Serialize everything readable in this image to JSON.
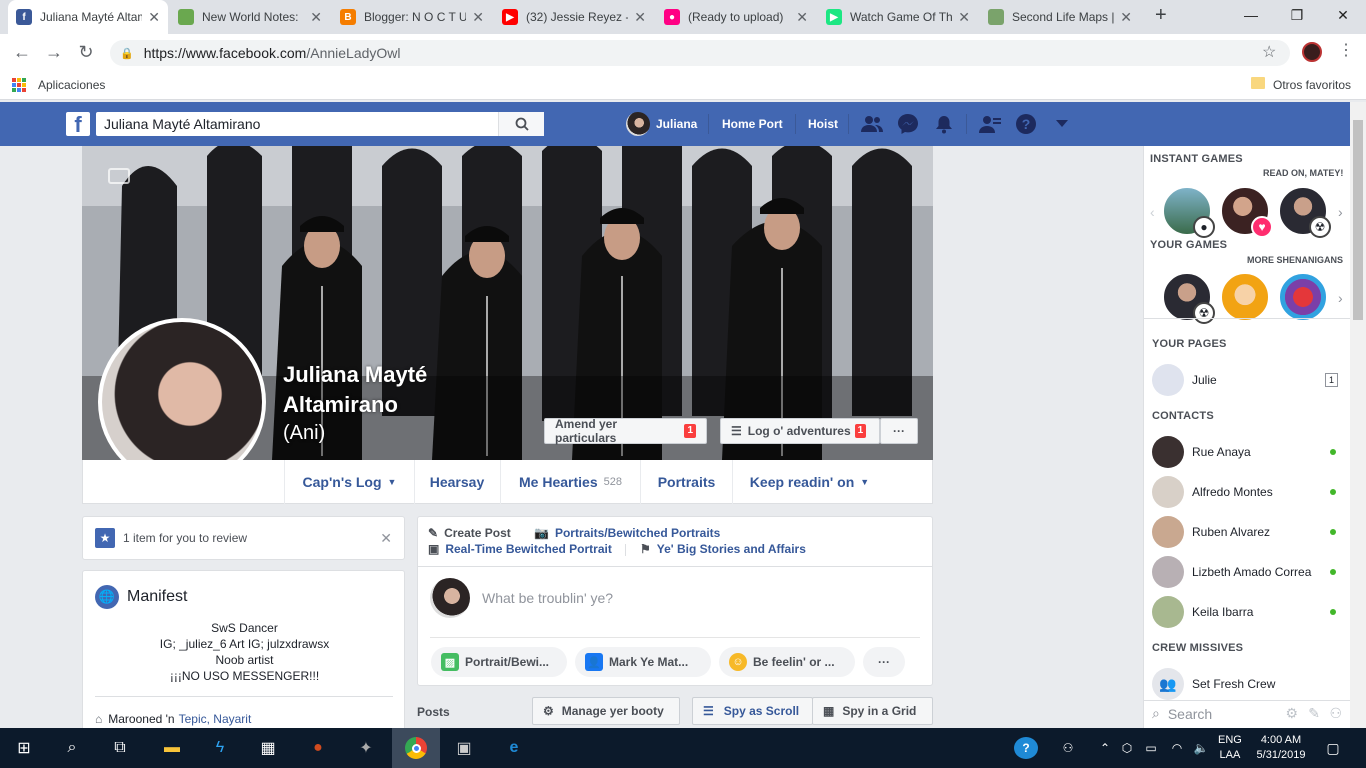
{
  "browser": {
    "tabs": [
      {
        "title": "Juliana Mayté Altami",
        "color": "#3b5998",
        "glyph": "f",
        "active": true
      },
      {
        "title": "New World Notes: ",
        "color": "#6aa84f",
        "glyph": "",
        "active": false
      },
      {
        "title": "Blogger: N O C T U",
        "color": "#f57d00",
        "glyph": "B",
        "active": false
      },
      {
        "title": "(32) Jessie Reyez - ",
        "color": "#ff0000",
        "glyph": "▶",
        "active": false
      },
      {
        "title": "(Ready to upload) ",
        "color": "#ff0084",
        "glyph": "●",
        "active": false
      },
      {
        "title": "Watch Game Of Thr",
        "color": "#1ce783",
        "glyph": "▶",
        "active": false
      },
      {
        "title": "Second Life Maps | ",
        "color": "#7aa36b",
        "glyph": "",
        "active": false
      }
    ],
    "new_tab": "+",
    "url_host": "https://www.facebook.com",
    "url_path": "/AnnieLadyOwl",
    "bookmarks_apps": "Aplicaciones",
    "bookmarks_other": "Otros favoritos"
  },
  "fb": {
    "search_value": "Juliana Mayté Altamirano",
    "nav_user": "Juliana",
    "nav_home": "Home Port",
    "nav_hoist": "Hoist"
  },
  "profile": {
    "name_line1": "Juliana Mayté",
    "name_line2": "Altamirano",
    "alt_name": "(Ani)",
    "btn_edit": "Amend yer particulars",
    "btn_edit_badge": "1",
    "btn_log": "Log o' adventures",
    "btn_log_badge": "1",
    "btn_more": "···",
    "tabs": [
      {
        "label": "Cap'n's Log",
        "count": "",
        "caret": true
      },
      {
        "label": "Hearsay",
        "count": "",
        "caret": false
      },
      {
        "label": "Me Hearties",
        "count": "528",
        "caret": false
      },
      {
        "label": "Portraits",
        "count": "",
        "caret": false
      },
      {
        "label": "Keep readin' on",
        "count": "",
        "caret": true
      }
    ]
  },
  "review": {
    "text": "1 item for you to review"
  },
  "intro": {
    "title": "Manifest",
    "bio": [
      "SwS Dancer",
      "IG; _juliez_6 Art IG; julzxdrawsx",
      "Noob artist",
      "¡¡¡NO USO MESSENGER!!!"
    ],
    "location_prefix": "Marooned 'n",
    "location_link": "Tepic, Nayarit"
  },
  "composer": {
    "create_post": "Create Post",
    "photo_album": "Portraits/Bewitched Portraits",
    "live_video": "Real-Time Bewitched Portrait",
    "life_event": "Ye' Big Stories and Affairs",
    "placeholder": "What be troublin' ye?",
    "pill_photo": "Portrait/Bewi...",
    "pill_tag": "Mark Ye Mat...",
    "pill_feeling": "Be feelin' or ...",
    "pill_more": "···"
  },
  "posts": {
    "title": "Posts",
    "manage": "Manage yer booty",
    "list_view": "Spy as Scroll",
    "grid_view": "Spy in a Grid"
  },
  "sidebar": {
    "instant_games": "INSTANT GAMES",
    "read_on": "READ ON, MATEY!",
    "your_games": "YOUR GAMES",
    "more": "MORE SHENANIGANS",
    "your_pages": "YOUR PAGES",
    "page_name": "Julie",
    "page_count": "1",
    "contacts_title": "CONTACTS",
    "contacts": [
      "Rue Anaya",
      "Alfredo Montes",
      "Ruben Alvarez",
      "Lizbeth Amado Correa",
      "Keila Ibarra"
    ],
    "crew_title": "CREW MISSIVES",
    "crew_new": "Set Fresh Crew",
    "search": "Search"
  },
  "taskbar": {
    "lang1": "ENG",
    "lang2": "LAA",
    "time": "4:00 AM",
    "date": "5/31/2019"
  }
}
